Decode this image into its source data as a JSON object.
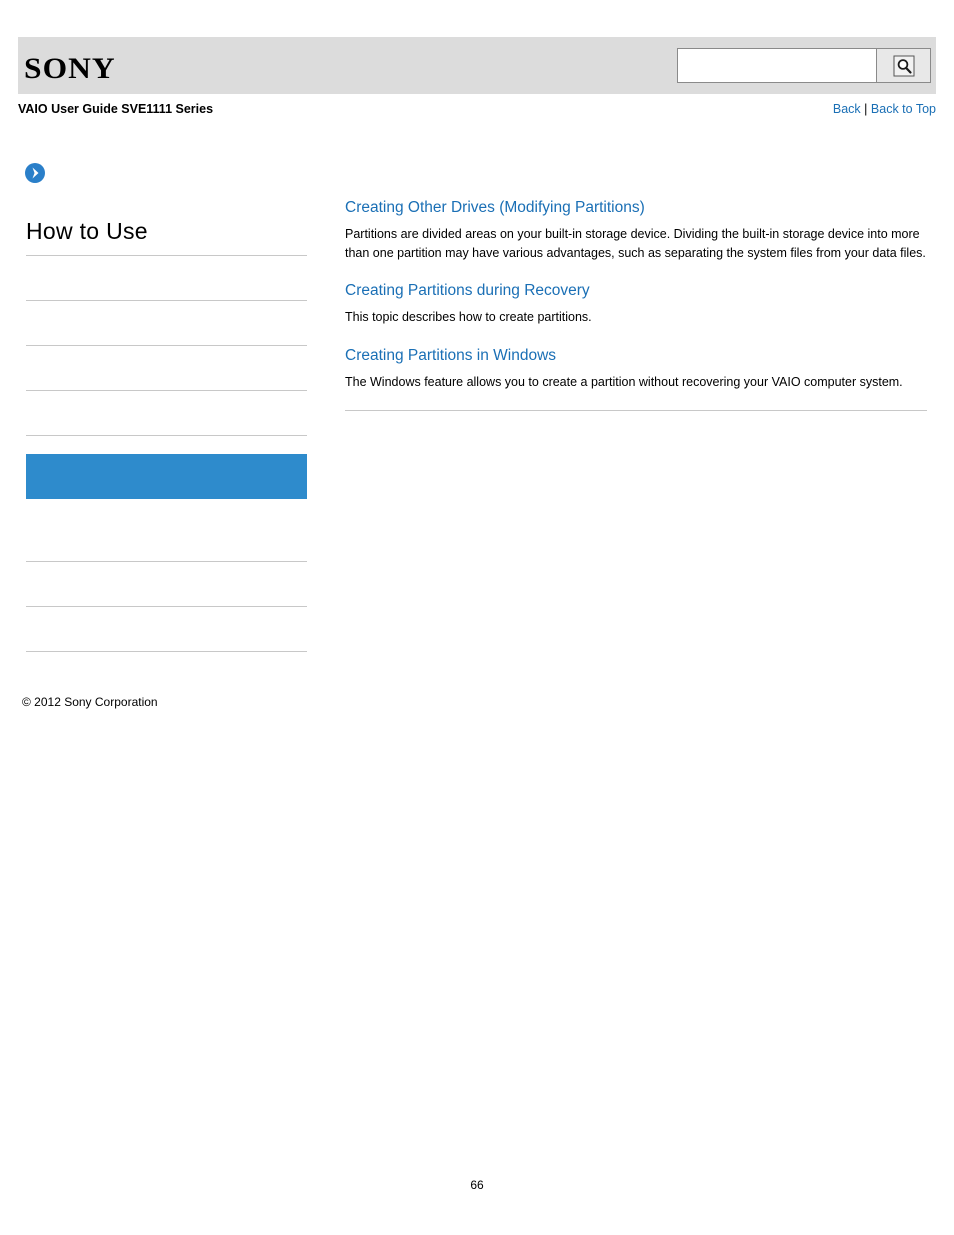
{
  "header": {
    "logo_text": "SONY",
    "search": {
      "value": "",
      "placeholder": "",
      "icon": "search-icon"
    }
  },
  "title_row": {
    "guide_title": "VAIO User Guide SVE1111 Series",
    "back_label": "Back",
    "separator": "|",
    "back_to_top_label": "Back to Top"
  },
  "sidebar": {
    "heading": "How to Use",
    "items": [
      {
        "label": "",
        "selected": false
      },
      {
        "label": "",
        "selected": false
      },
      {
        "label": "",
        "selected": false
      },
      {
        "label": "",
        "selected": false
      },
      {
        "label": "",
        "selected": true
      },
      {
        "label": "",
        "selected": false
      },
      {
        "label": "",
        "selected": false
      },
      {
        "label": "",
        "selected": false
      }
    ]
  },
  "content": {
    "topics": [
      {
        "title": "Creating Other Drives (Modifying Partitions)",
        "description": "Partitions are divided areas on your built-in storage device. Dividing the built-in storage device into more than one partition may have various advantages, such as separating the system files from your data files."
      },
      {
        "title": "Creating Partitions during Recovery",
        "description": "This topic describes how to create partitions."
      },
      {
        "title": "Creating Partitions in Windows",
        "description": "The Windows feature allows you to create a partition without recovering your VAIO computer system."
      }
    ]
  },
  "footer": {
    "copyright": "© 2012 Sony Corporation",
    "page_number": "66"
  }
}
